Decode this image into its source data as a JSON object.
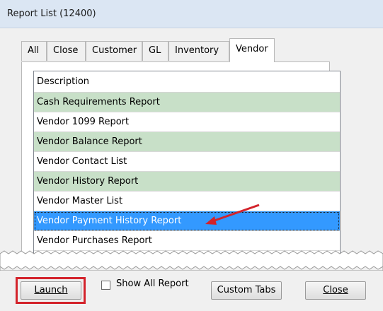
{
  "window": {
    "title": "Report List (12400)"
  },
  "tabs": [
    {
      "label": "All"
    },
    {
      "label": "Close"
    },
    {
      "label": "Customer"
    },
    {
      "label": "GL"
    },
    {
      "label": "Inventory"
    },
    {
      "label": "Vendor",
      "active": true
    }
  ],
  "list": {
    "header": "Description",
    "rows": [
      {
        "label": "Cash Requirements Report"
      },
      {
        "label": "Vendor 1099 Report"
      },
      {
        "label": "Vendor Balance Report"
      },
      {
        "label": "Vendor Contact List"
      },
      {
        "label": "Vendor History Report"
      },
      {
        "label": "Vendor Master List"
      },
      {
        "label": "Vendor Payment History Report",
        "selected": true
      },
      {
        "label": "Vendor Purchases Report"
      }
    ]
  },
  "footer": {
    "launch_label": "Launch",
    "show_all_label": "Show All Report",
    "show_all_checked": false,
    "custom_tabs_label": "Custom Tabs",
    "close_label": "Close"
  },
  "colors": {
    "row_alt": "#c8e0c8",
    "selection": "#3399ff",
    "highlight": "#d3232b",
    "arrow": "#d3232b"
  }
}
